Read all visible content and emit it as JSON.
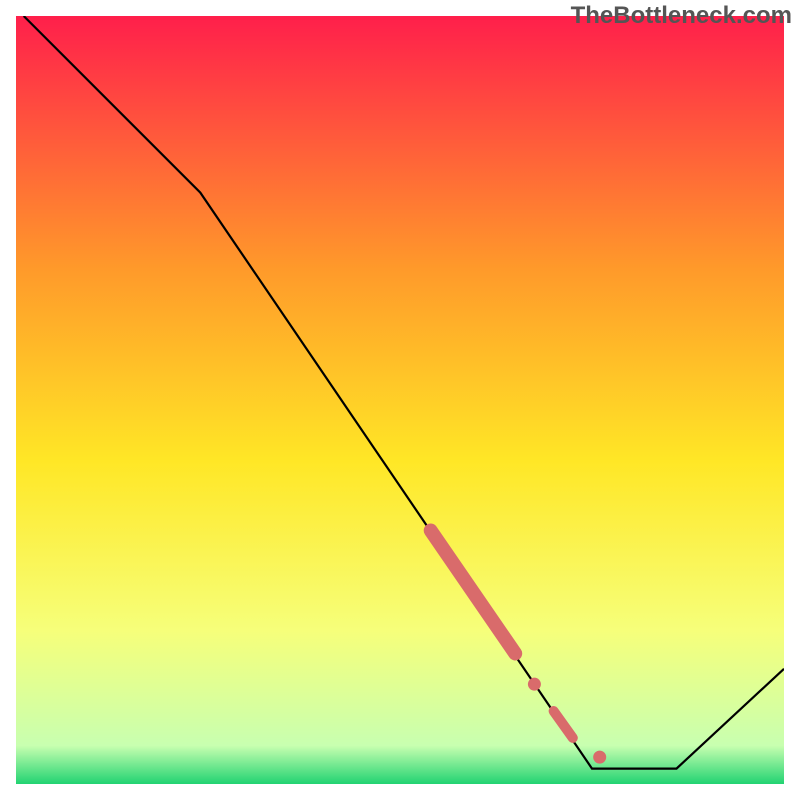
{
  "watermark": "TheBottleneck.com",
  "chart_data": {
    "type": "line",
    "title": "",
    "xlabel": "",
    "ylabel": "",
    "xlim": [
      0,
      100
    ],
    "ylim": [
      0,
      100
    ],
    "background_gradient": {
      "top": "#ff1f4b",
      "mid_upper": "#ff9a2a",
      "mid": "#ffe726",
      "mid_lower": "#f6ff7a",
      "bottom": "#22d372"
    },
    "series": [
      {
        "name": "bottleneck-curve",
        "color": "#000000",
        "points": [
          {
            "x": 1,
            "y": 100
          },
          {
            "x": 24,
            "y": 77
          },
          {
            "x": 75,
            "y": 2
          },
          {
            "x": 86,
            "y": 2
          },
          {
            "x": 100,
            "y": 15
          }
        ]
      }
    ],
    "markers": [
      {
        "name": "highlight-segment",
        "color": "#d96b6b",
        "type": "thick-segment",
        "start": {
          "x": 54,
          "y": 33
        },
        "end": {
          "x": 65,
          "y": 17
        }
      },
      {
        "name": "dot-1",
        "color": "#d96b6b",
        "type": "dot",
        "x": 67.5,
        "y": 13
      },
      {
        "name": "dot-2",
        "color": "#d96b6b",
        "type": "dot-segment",
        "start": {
          "x": 70,
          "y": 9.5
        },
        "end": {
          "x": 72.5,
          "y": 6
        }
      },
      {
        "name": "dot-3",
        "color": "#d96b6b",
        "type": "dot",
        "x": 76,
        "y": 3.5
      }
    ]
  }
}
